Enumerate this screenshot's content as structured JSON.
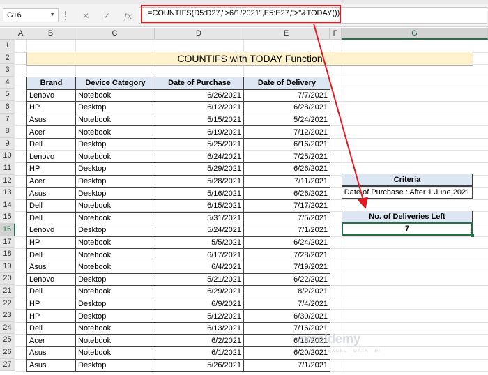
{
  "formula_bar": {
    "name_box": "G16",
    "cancel_icon": "x-icon",
    "enter_icon": "check-icon",
    "function_icon": "fx-icon",
    "fx_label": "fx",
    "formula": "=COUNTIFS(D5:D27,\">6/1/2021\",E5:E27,\">\"&TODAY())"
  },
  "columns": [
    "A",
    "B",
    "C",
    "D",
    "E",
    "F",
    "G"
  ],
  "rows": [
    "1",
    "2",
    "3",
    "4",
    "5",
    "6",
    "7",
    "8",
    "9",
    "10",
    "11",
    "12",
    "13",
    "14",
    "15",
    "16",
    "17",
    "18",
    "19",
    "20",
    "21",
    "22",
    "23",
    "24",
    "25",
    "26",
    "27"
  ],
  "title": "COUNTIFS with TODAY Function",
  "table": {
    "headers": [
      "Brand",
      "Device Category",
      "Date of Purchase",
      "Date of Delivery"
    ],
    "rows": [
      [
        "Lenovo",
        "Notebook",
        "6/26/2021",
        "7/7/2021"
      ],
      [
        "HP",
        "Desktop",
        "6/12/2021",
        "6/28/2021"
      ],
      [
        "Asus",
        "Notebook",
        "5/15/2021",
        "5/24/2021"
      ],
      [
        "Acer",
        "Notebook",
        "6/19/2021",
        "7/12/2021"
      ],
      [
        "Dell",
        "Desktop",
        "5/25/2021",
        "6/16/2021"
      ],
      [
        "Lenovo",
        "Notebook",
        "6/24/2021",
        "7/25/2021"
      ],
      [
        "HP",
        "Desktop",
        "5/29/2021",
        "6/26/2021"
      ],
      [
        "Acer",
        "Desktop",
        "5/28/2021",
        "7/11/2021"
      ],
      [
        "Asus",
        "Desktop",
        "5/16/2021",
        "6/26/2021"
      ],
      [
        "Dell",
        "Notebook",
        "6/15/2021",
        "7/17/2021"
      ],
      [
        "Dell",
        "Notebook",
        "5/31/2021",
        "7/5/2021"
      ],
      [
        "Lenovo",
        "Desktop",
        "5/24/2021",
        "7/1/2021"
      ],
      [
        "HP",
        "Notebook",
        "5/5/2021",
        "6/24/2021"
      ],
      [
        "Dell",
        "Notebook",
        "6/17/2021",
        "7/28/2021"
      ],
      [
        "Asus",
        "Notebook",
        "6/4/2021",
        "7/19/2021"
      ],
      [
        "Lenovo",
        "Desktop",
        "5/21/2021",
        "6/22/2021"
      ],
      [
        "Dell",
        "Notebook",
        "6/29/2021",
        "8/2/2021"
      ],
      [
        "HP",
        "Desktop",
        "6/9/2021",
        "7/4/2021"
      ],
      [
        "HP",
        "Desktop",
        "5/12/2021",
        "6/30/2021"
      ],
      [
        "Dell",
        "Notebook",
        "6/13/2021",
        "7/16/2021"
      ],
      [
        "Acer",
        "Notebook",
        "6/2/2021",
        "6/18/2021"
      ],
      [
        "Asus",
        "Notebook",
        "6/1/2021",
        "6/20/2021"
      ],
      [
        "Asus",
        "Desktop",
        "5/26/2021",
        "7/1/2021"
      ]
    ]
  },
  "criteria": {
    "label": "Criteria",
    "value": "Date of Purchase : After 1 June,2021"
  },
  "result": {
    "label": "No. of Deliveries Left",
    "value": "7"
  },
  "watermark": {
    "brand": "exceldemy",
    "tagline": "EXCEL · DATA · BI"
  },
  "colors": {
    "title_fill": "#fff2cc",
    "header_fill": "#dde6f3",
    "highlight_red": "#e21b23",
    "selection_green": "#217346"
  }
}
